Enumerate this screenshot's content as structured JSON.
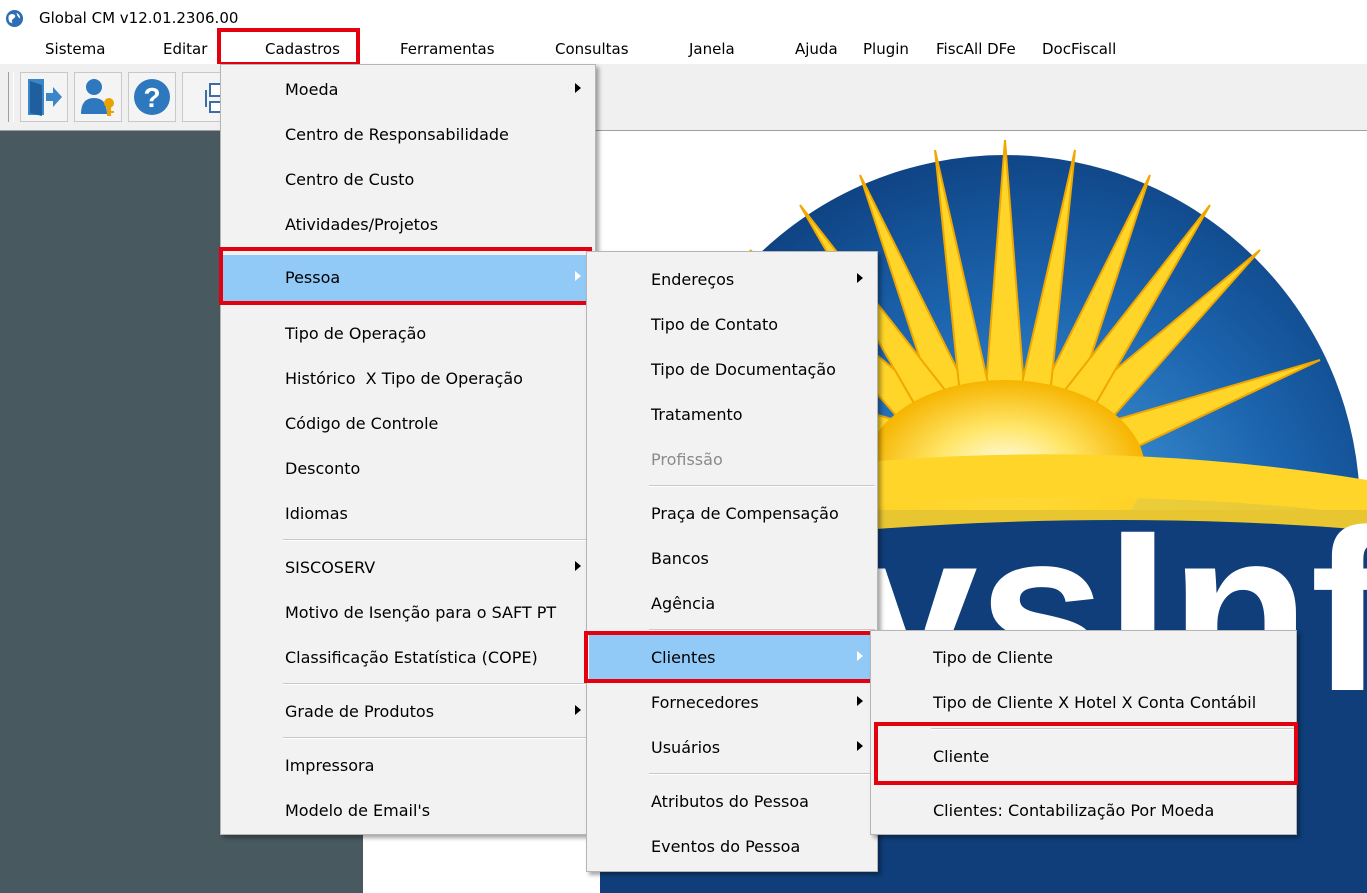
{
  "window": {
    "title": "Global CM v12.01.2306.00"
  },
  "menubar": [
    {
      "label": "Sistema"
    },
    {
      "label": "Editar"
    },
    {
      "label": "Cadastros"
    },
    {
      "label": "Ferramentas"
    },
    {
      "label": "Consultas"
    },
    {
      "label": "Janela"
    },
    {
      "label": "Ajuda"
    },
    {
      "label": "Plugin"
    },
    {
      "label": "FiscAll DFe"
    },
    {
      "label": "DocFiscall"
    }
  ],
  "toolbar": {
    "icons": [
      "exit-icon",
      "user-key-icon",
      "help-icon",
      "org-chart-icon"
    ]
  },
  "cadastros_menu": [
    {
      "label": "Moeda",
      "submenu": true
    },
    {
      "label": "Centro de Responsabilidade"
    },
    {
      "label": "Centro de Custo"
    },
    {
      "label": "Atividades/Projetos"
    },
    {
      "label": "Pessoa",
      "submenu": true,
      "selected": true
    },
    {
      "label": "Tipo de Operação"
    },
    {
      "label": "Histórico  X Tipo de Operação"
    },
    {
      "label": "Código de Controle"
    },
    {
      "label": "Desconto"
    },
    {
      "label": "Idiomas"
    },
    {
      "label": "SISCOSERV",
      "submenu": true
    },
    {
      "label": "Motivo de Isenção para o SAFT PT"
    },
    {
      "label": "Classificação Estatística (COPE)"
    },
    {
      "label": "Grade de Produtos",
      "submenu": true
    },
    {
      "label": "Impressora"
    },
    {
      "label": "Modelo de Email's"
    }
  ],
  "pessoa_menu": [
    {
      "label": "Endereços",
      "submenu": true
    },
    {
      "label": "Tipo de Contato"
    },
    {
      "label": "Tipo de Documentação"
    },
    {
      "label": "Tratamento"
    },
    {
      "label": "Profissão",
      "disabled": true
    },
    {
      "label": "Praça de Compensação"
    },
    {
      "label": "Bancos"
    },
    {
      "label": "Agência"
    },
    {
      "label": "Clientes",
      "submenu": true,
      "selected": true
    },
    {
      "label": "Fornecedores",
      "submenu": true
    },
    {
      "label": "Usuários",
      "submenu": true
    },
    {
      "label": "Atributos do Pessoa"
    },
    {
      "label": "Eventos do Pessoa"
    }
  ],
  "clientes_menu": [
    {
      "label": "Tipo de Cliente"
    },
    {
      "label": "Tipo de Cliente X Hotel X Conta Contábil"
    },
    {
      "label": "Cliente"
    },
    {
      "label": "Clientes: Contabilização Por Moeda"
    }
  ],
  "colors": {
    "highlight_border": "#e3000f",
    "selected_item": "#91c9f7",
    "left_panel": "#485a5f"
  }
}
